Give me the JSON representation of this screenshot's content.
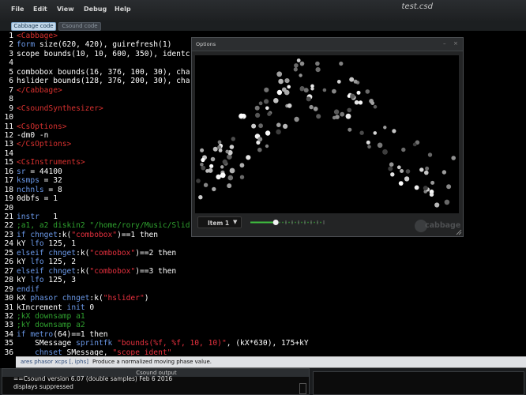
{
  "menu": [
    "File",
    "Edit",
    "View",
    "Debug",
    "Help"
  ],
  "window_title": "test.csd",
  "tabs": {
    "cabbage": "Cabbage code",
    "csound": "Csound code"
  },
  "code": [
    [
      {
        "c": "tag",
        "t": "<Cabbage>"
      }
    ],
    [
      {
        "c": "kw",
        "t": "form"
      },
      {
        "c": "txt",
        "t": " size(620, 420), guirefresh(1)"
      }
    ],
    [
      {
        "c": "txt",
        "t": "scope bounds(10, 10, 600, 350), identc"
      }
    ],
    [],
    [
      {
        "c": "txt",
        "t": "combobox bounds(16, 376, 100, 30), cha"
      }
    ],
    [
      {
        "c": "txt",
        "t": "hslider bounds(128, 376, 200, 30), cha"
      }
    ],
    [
      {
        "c": "tag",
        "t": "</Cabbage>"
      }
    ],
    [],
    [
      {
        "c": "tag",
        "t": "<CsoundSynthesizer>"
      }
    ],
    [],
    [
      {
        "c": "tag",
        "t": "<CsOptions>"
      }
    ],
    [
      {
        "c": "txt",
        "t": "-dm0 -n"
      }
    ],
    [
      {
        "c": "tag",
        "t": "</CsOptions>"
      }
    ],
    [],
    [
      {
        "c": "tag",
        "t": "<CsInstruments>"
      }
    ],
    [
      {
        "c": "kw",
        "t": "sr"
      },
      {
        "c": "txt",
        "t": " = 44100"
      }
    ],
    [
      {
        "c": "kw",
        "t": "ksmps"
      },
      {
        "c": "txt",
        "t": " = 32"
      }
    ],
    [
      {
        "c": "kw",
        "t": "nchnls"
      },
      {
        "c": "txt",
        "t": " = 8"
      }
    ],
    [
      {
        "c": "txt",
        "t": "0dbfs = 1"
      }
    ],
    [],
    [
      {
        "c": "kw",
        "t": "instr"
      },
      {
        "c": "txt",
        "t": "   1"
      }
    ],
    [
      {
        "c": "cmt",
        "t": ";a1, a2 diskin2 \"/home/rory/Music/Slid"
      }
    ],
    [
      {
        "c": "kw",
        "t": "if chnget"
      },
      {
        "c": "txt",
        "t": ":k("
      },
      {
        "c": "str",
        "t": "\"combobox\""
      },
      {
        "c": "txt",
        "t": ")==1 then"
      }
    ],
    [
      {
        "c": "txt",
        "t": "kY "
      },
      {
        "c": "kw",
        "t": "lfo"
      },
      {
        "c": "txt",
        "t": " 125, 1"
      }
    ],
    [
      {
        "c": "kw",
        "t": "elseif chnget"
      },
      {
        "c": "txt",
        "t": ":k("
      },
      {
        "c": "str",
        "t": "\"combobox\""
      },
      {
        "c": "txt",
        "t": ")==2 then"
      }
    ],
    [
      {
        "c": "txt",
        "t": "kY "
      },
      {
        "c": "kw",
        "t": "lfo"
      },
      {
        "c": "txt",
        "t": " 125, 2"
      }
    ],
    [
      {
        "c": "kw",
        "t": "elseif chnget"
      },
      {
        "c": "txt",
        "t": ":k("
      },
      {
        "c": "str",
        "t": "\"combobox\""
      },
      {
        "c": "txt",
        "t": ")==3 then"
      }
    ],
    [
      {
        "c": "txt",
        "t": "kY "
      },
      {
        "c": "kw",
        "t": "lfo"
      },
      {
        "c": "txt",
        "t": " 125, 3"
      }
    ],
    [
      {
        "c": "kw",
        "t": "endif"
      }
    ],
    [
      {
        "c": "txt",
        "t": "kX "
      },
      {
        "c": "kw",
        "t": "phasor chnget"
      },
      {
        "c": "txt",
        "t": ":k("
      },
      {
        "c": "str",
        "t": "\"hslider\""
      },
      {
        "c": "txt",
        "t": ")"
      }
    ],
    [
      {
        "c": "txt",
        "t": "kIncrement "
      },
      {
        "c": "kw",
        "t": "init"
      },
      {
        "c": "txt",
        "t": " 0"
      }
    ],
    [
      {
        "c": "cmt",
        "t": ";kX downsamp a1"
      }
    ],
    [
      {
        "c": "cmt",
        "t": ";kY downsamp a2"
      }
    ],
    [
      {
        "c": "kw",
        "t": "if metro"
      },
      {
        "c": "txt",
        "t": "(64)==1 then"
      }
    ],
    [
      {
        "c": "txt",
        "t": "    SMessage "
      },
      {
        "c": "kw",
        "t": "sprintfk"
      },
      {
        "c": "txt",
        "t": " "
      },
      {
        "c": "str",
        "t": "\"bounds(%f, %f, 10, 10)\""
      },
      {
        "c": "txt",
        "t": ", (kX*630), 175+kY"
      }
    ],
    [
      {
        "c": "txt",
        "t": "    "
      },
      {
        "c": "kw",
        "t": "chnset"
      },
      {
        "c": "txt",
        "t": " SMessage, "
      },
      {
        "c": "str",
        "t": "\"scope_ident\""
      }
    ],
    [],
    []
  ],
  "hint": {
    "syntax": "ares phasor xcps [, iphs]",
    "description": "Produce a normalized moving phase value."
  },
  "output": {
    "title": "Csound output",
    "lines": [
      "==Csound version 6.07 (double samples) Feb  6 2016",
      "displays suppressed"
    ]
  },
  "plugin": {
    "title": "Options",
    "combobox_value": "Item 1",
    "slider_value": 0.35,
    "logo_text": "cabbage"
  }
}
